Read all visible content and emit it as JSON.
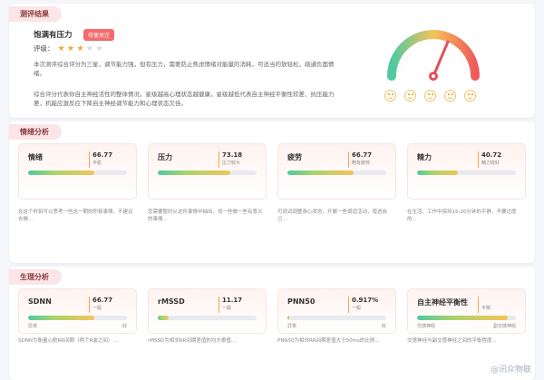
{
  "summary": {
    "tag": "测评结果",
    "title": "饱满有压力",
    "badge": "待留关注",
    "rating_label": "评级：",
    "rating": 3,
    "rating_max": 5,
    "p1": "本次测评综合评分为三星，调节能力强，但有压力，需要防止焦虑情绪对能量的消耗，可适当的放轻松，疏通负面情绪。",
    "p2": "综合评分代表你自主神经活性的整体情况，星级越高心理状态越健康，星级越低代表自主神经平衡性较差、抗压能力差，机能应激反应下降自主神经调节能力和心理状态欠佳。"
  },
  "emotion": {
    "tag": "情绪分析",
    "items": [
      {
        "name": "情绪",
        "value": "66.77",
        "level": "平稳",
        "pct": 0.67,
        "min": "",
        "max": ""
      },
      {
        "name": "压力",
        "value": "73.18",
        "level": "压力较大",
        "pct": 0.73,
        "min": "",
        "max": ""
      },
      {
        "name": "疲劳",
        "value": "66.77",
        "level": "略有疲劳",
        "pct": 0.67,
        "min": "",
        "max": ""
      },
      {
        "name": "精力",
        "value": "40.72",
        "level": "精力较好",
        "pct": 0.41,
        "min": "",
        "max": ""
      }
    ],
    "descs": [
      "在这个时刻可以思考一些这一期的积极事情，不建议去做...",
      "您需要暂时从这件事情中抽出，找一些做一些有意义的事情...",
      "可调试调整身心状态，开展一些调适活动，增进自己...",
      "在生活、工作中保持15-20分钟的平静，不要过度的..."
    ]
  },
  "physio": {
    "tag": "生理分析",
    "items": [
      {
        "name": "SDNN",
        "value": "66.77",
        "level": "一般",
        "pct": 0.67,
        "min": "异常",
        "max": "好"
      },
      {
        "name": "rMSSD",
        "value": "11.17",
        "level": "一般",
        "pct": 0.11,
        "min": "",
        "max": ""
      },
      {
        "name": "PNN50",
        "value": "0.917%",
        "level": "一般",
        "pct": 0.01,
        "min": "异常",
        "max": "好"
      },
      {
        "name": "自主神经平衡性",
        "value": "",
        "level": "平衡",
        "pct": 0.92,
        "min": "交感神经",
        "max": "副交感神经"
      }
    ],
    "descs": [
      "SDNN为衡量心脏RR间期（两个R波之间）...",
      "rMSSD为相邻RR间期差值的均方根值...",
      "PNN50为相邻RR间期差值大于50ms的比例...",
      "交感神经与副交感神经之间的平衡程度..."
    ]
  },
  "watermark": "@讯众物联",
  "colors": {
    "accent_red": "#f36a6a",
    "star": "#f5a623",
    "bar_gradient": [
      "#4ec9a0",
      "#a8d56a",
      "#f5c35a"
    ]
  }
}
